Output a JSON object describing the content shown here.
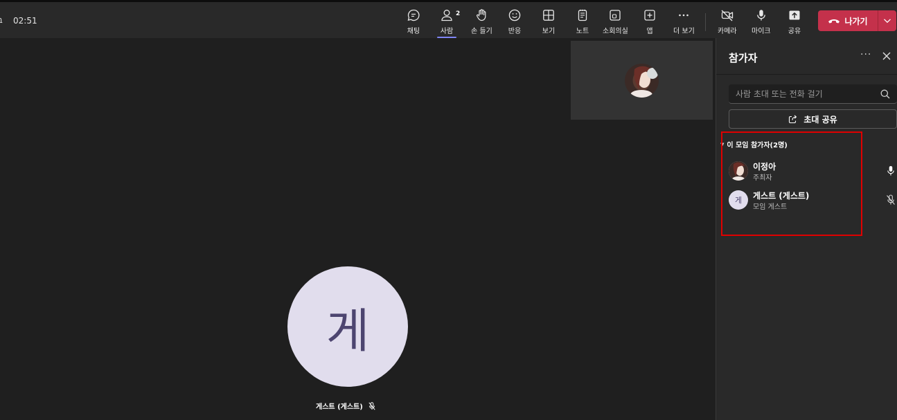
{
  "topbar": {
    "timer": "02:51",
    "buttons": {
      "chat": "채팅",
      "people": "사람",
      "people_count": "2",
      "raise_hand": "손 들기",
      "react": "반응",
      "view": "보기",
      "notes": "노트",
      "rooms": "소회의실",
      "apps": "앱",
      "more": "더 보기",
      "camera": "카메라",
      "mic": "마이크",
      "share": "공유"
    },
    "leave_label": "나가기",
    "leave_color": "#c4314b",
    "active_tab_color": "#7f85f5"
  },
  "stage": {
    "avatar_initial": "게",
    "name_label": "게스트 (게스트)"
  },
  "panel": {
    "title": "참가자",
    "search_placeholder": "사람 초대 또는 전화 걸기",
    "share_invite_label": "초대 공유",
    "section_title": "이 모임 참가자(2명)",
    "participants": [
      {
        "name": "이정아",
        "role": "주최자",
        "mic": "mic-on"
      },
      {
        "name": "게스트 (게스트)",
        "role": "모임 게스트",
        "initial": "게",
        "mic": "mic-off"
      }
    ]
  },
  "highlight_color": "#e00000"
}
